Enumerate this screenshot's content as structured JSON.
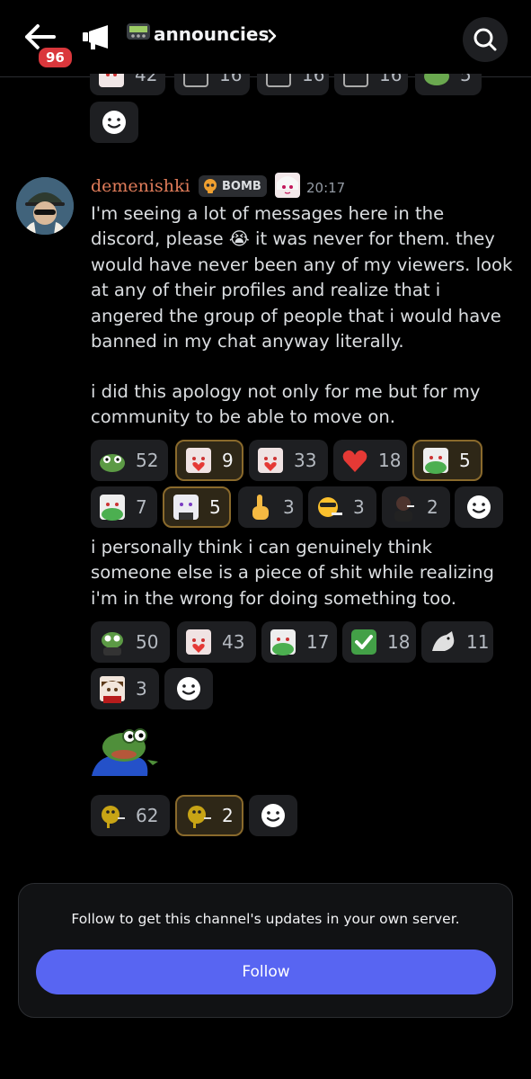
{
  "header": {
    "unread_count": "96",
    "channel_name": "announcies"
  },
  "message": {
    "author": "demenishki",
    "tag": "BOMB",
    "time": "20:17",
    "paragraph1": "I'm seeing a lot of messages here in the discord, please 😭 it was never for them. they would have never been any of my viewers. look at any of their profiles and realize that i angered the group of people that i would have banned in my chat anyway literally.",
    "paragraph2": "i did this apology not only for me but for my community to be able to move on.",
    "paragraph3": "i personally think i can genuinely think someone else is a piece of shit while realizing i'm in the wrong for doing something too."
  },
  "top_partial_reactions": [
    {
      "emoji": "anime-girl-emoji",
      "count": "42"
    },
    {
      "emoji": "letter-t-emoji",
      "count": "16"
    },
    {
      "emoji": "letter-r-emoji",
      "count": "16"
    },
    {
      "emoji": "letter-y-emoji",
      "count": "16"
    },
    {
      "emoji": "pepe-emoji",
      "count": "5"
    }
  ],
  "reactions_1": [
    {
      "emoji": "pepe-emoji",
      "count": "52",
      "me": false
    },
    {
      "emoji": "anime-girl-heart-emoji",
      "count": "9",
      "me": true
    },
    {
      "emoji": "anime-girl-heart-emoji",
      "count": "33",
      "me": false
    },
    {
      "emoji": "red-heart-emoji",
      "count": "18",
      "me": false
    },
    {
      "emoji": "anime-girl-pepe-emoji",
      "count": "5",
      "me": true
    },
    {
      "emoji": "anime-girl-pepe-emoji",
      "count": "7",
      "me": false
    },
    {
      "emoji": "anime-girl-suit-emoji",
      "count": "5",
      "me": true
    },
    {
      "emoji": "pointing-up-emoji",
      "count": "3",
      "me": false
    },
    {
      "emoji": "sunglasses-smoking-emoji",
      "count": "3",
      "me": false
    },
    {
      "emoji": "person-smoking-emoji",
      "count": "2",
      "me": false
    }
  ],
  "reactions_2": [
    {
      "emoji": "pepe-suit-emoji",
      "count": "50",
      "me": false
    },
    {
      "emoji": "anime-girl-heart-emoji",
      "count": "43",
      "me": false
    },
    {
      "emoji": "anime-girl-pepe-emoji",
      "count": "17",
      "me": false
    },
    {
      "emoji": "check-mark-emoji",
      "count": "18",
      "me": false
    },
    {
      "emoji": "white-dog-emoji",
      "count": "11",
      "me": false
    },
    {
      "emoji": "anime-boy-emoji",
      "count": "3",
      "me": false
    }
  ],
  "reactions_3": [
    {
      "emoji": "smoking-ball-emoji",
      "count": "62",
      "me": false
    },
    {
      "emoji": "smoking-ball-emoji",
      "count": "2",
      "me": true
    }
  ],
  "follow": {
    "text": "Follow to get this channel's updates in your own server.",
    "button_label": "Follow"
  },
  "colors": {
    "background": "#000000",
    "username": "#e07c5a",
    "follow_button": "#5865f2",
    "badge": "#da373c",
    "own_reaction_border": "#8a6a2c"
  }
}
